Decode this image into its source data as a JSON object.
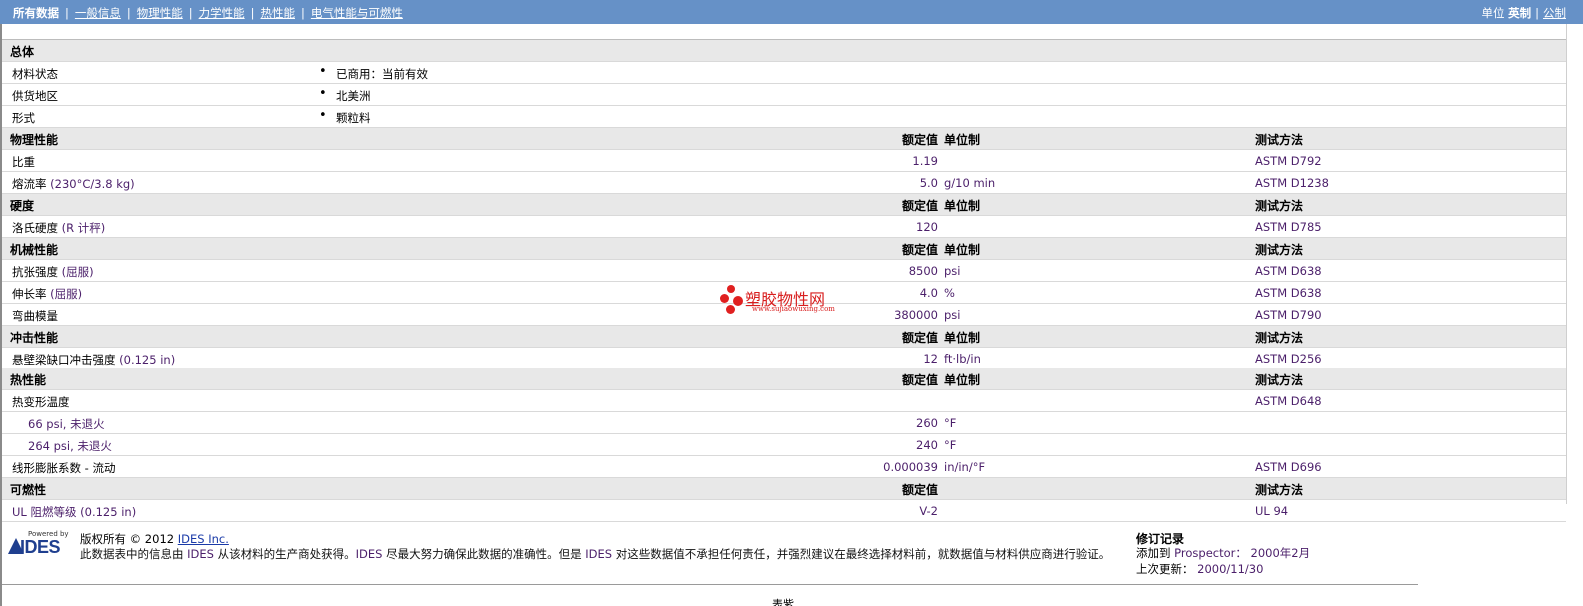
{
  "nav": {
    "items": [
      {
        "label": "所有数据",
        "active": true
      },
      {
        "label": "一般信息"
      },
      {
        "label": "物理性能"
      },
      {
        "label": "力学性能"
      },
      {
        "label": "热性能"
      },
      {
        "label": "电气性能与可燃性"
      }
    ],
    "units_label": "单位",
    "units_current": "英制",
    "units_other": "公制"
  },
  "column_headers": {
    "value": "额定值",
    "unit": "单位制",
    "method": "测试方法"
  },
  "general": {
    "title": "总体",
    "rows": [
      {
        "name": "材料状态",
        "value": "已商用：当前有效"
      },
      {
        "name": "供货地区",
        "value": "北美洲"
      },
      {
        "name": "形式",
        "value": "颗粒料"
      }
    ]
  },
  "physical": {
    "title": "物理性能",
    "rows": [
      {
        "name": "比重",
        "value": "1.19",
        "unit": "",
        "method": "ASTM D792"
      },
      {
        "name": "熔流率",
        "cond": "(230°C/3.8 kg)",
        "value": "5.0",
        "unit": "g/10 min",
        "method": "ASTM D1238"
      }
    ]
  },
  "hardness": {
    "title": "硬度",
    "rows": [
      {
        "name": "洛氏硬度",
        "cond": "(R 计秤)",
        "value": "120",
        "unit": "",
        "method": "ASTM D785"
      }
    ]
  },
  "mechanical": {
    "title": "机械性能",
    "rows": [
      {
        "name": "抗张强度",
        "cond": "(屈服)",
        "value": "8500",
        "unit": "psi",
        "method": "ASTM D638"
      },
      {
        "name": "伸长率",
        "cond": "(屈服)",
        "value": "4.0",
        "unit": "%",
        "method": "ASTM D638"
      },
      {
        "name": "弯曲模量",
        "value": "380000",
        "unit": "psi",
        "method": "ASTM D790"
      }
    ]
  },
  "impact": {
    "title": "冲击性能",
    "rows": [
      {
        "name": "悬壁梁缺口冲击强度",
        "cond": "(0.125 in)",
        "value": "12",
        "unit": "ft·lb/in",
        "method": "ASTM D256"
      }
    ]
  },
  "thermal": {
    "title": "热性能",
    "rows": [
      {
        "name": "热变形温度",
        "value": "",
        "unit": "",
        "method": "ASTM D648"
      },
      {
        "name": "66 psi, 未退火",
        "value": "260",
        "unit": "°F",
        "method": ""
      },
      {
        "name": "264 psi, 未退火",
        "value": "240",
        "unit": "°F",
        "method": ""
      },
      {
        "name": "线形膨胀系数",
        "cond": " - 流动",
        "value": "0.000039",
        "unit": "in/in/°F",
        "method": "ASTM D696"
      }
    ]
  },
  "flammability": {
    "title": "可燃性",
    "rows": [
      {
        "name": "UL 阻燃等级",
        "cond": "(0.125 in)",
        "value": "V-2",
        "unit": "",
        "method": "UL 94"
      }
    ]
  },
  "watermark": {
    "title": "塑胶物性网",
    "url": "www.sujiaowuxing.com"
  },
  "footer": {
    "logo_powered": "Powered by",
    "logo_brand": "IDES",
    "copyright": "版权所有 © 2012",
    "copyright_link": "IDES Inc.",
    "disclaimer_a": "此数据表中的信息由",
    "disclaimer_org": "IDES",
    "disclaimer_b": "从该材料的生产商处获得。",
    "disclaimer_c": "尽最大努力确保此数据的准确性。但是",
    "disclaimer_d": "对这些数据值不承担任何责任，并强烈建议在最终选择材料前，就数据值与材料供应商进行验证。",
    "revision_title": "修订记录",
    "added_label": "添加到",
    "added_source": "Prospector：",
    "added_date": "2000年2月",
    "updated_label": "上次更新：",
    "updated_date": "2000/11/30",
    "bottom_text": "表紫"
  }
}
